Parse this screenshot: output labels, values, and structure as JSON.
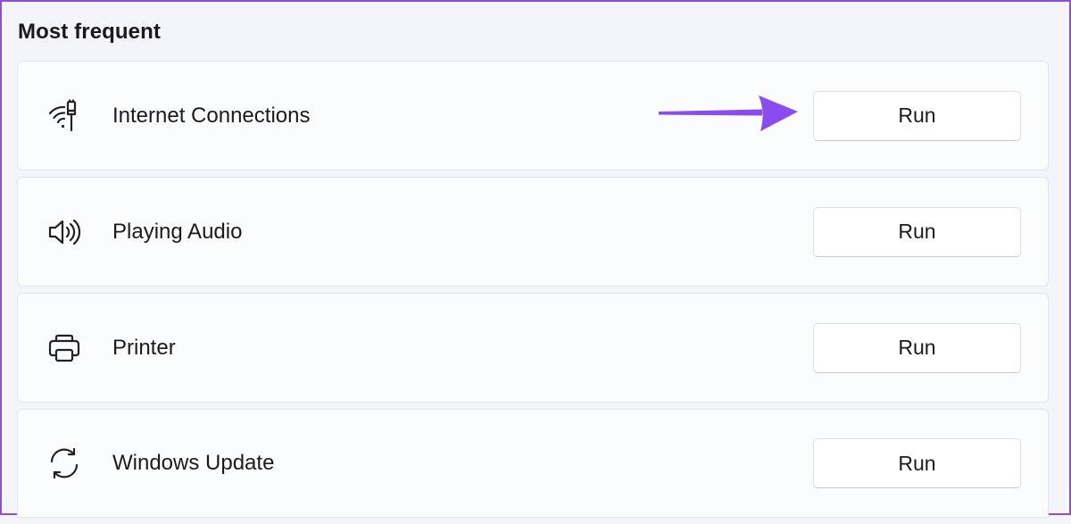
{
  "section": {
    "title": "Most frequent"
  },
  "items": [
    {
      "label": "Internet Connections",
      "icon": "wifi-ethernet-icon",
      "button_label": "Run"
    },
    {
      "label": "Playing Audio",
      "icon": "speaker-icon",
      "button_label": "Run"
    },
    {
      "label": "Printer",
      "icon": "printer-icon",
      "button_label": "Run"
    },
    {
      "label": "Windows Update",
      "icon": "sync-icon",
      "button_label": "Run"
    }
  ],
  "annotation": {
    "arrow_color": "#8a4cf0",
    "arrow_icon": "arrow-right-icon"
  },
  "colors": {
    "frame_border": "#8b4fd0",
    "background": "#f3f5fa",
    "card_background": "#fbfcfe"
  }
}
